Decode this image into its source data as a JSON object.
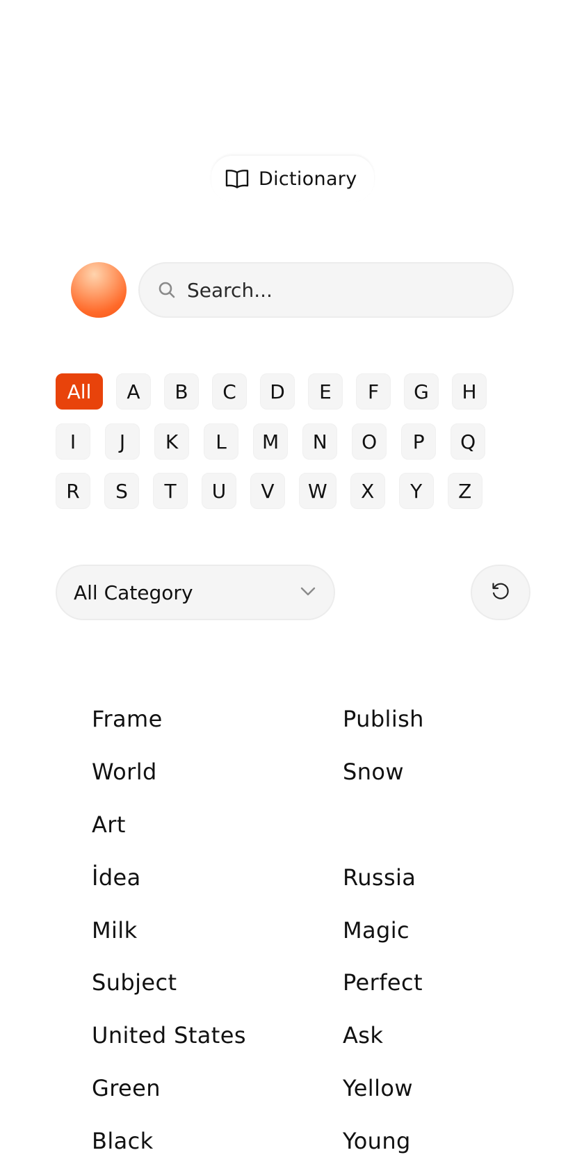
{
  "header": {
    "title": "Dictionary",
    "icon": "book-open-icon"
  },
  "search": {
    "placeholder": "Search...",
    "value": ""
  },
  "colors": {
    "accent": "#e8430b",
    "chip_bg": "#f5f5f5",
    "text": "#111111"
  },
  "letters": {
    "row1": [
      "All",
      "A",
      "B",
      "C",
      "D",
      "E",
      "F",
      "G",
      "H"
    ],
    "row2": [
      "I",
      "J",
      "K",
      "L",
      "M",
      "N",
      "O",
      "P",
      "Q"
    ],
    "row3": [
      "R",
      "S",
      "T",
      "U",
      "V",
      "W",
      "X",
      "Y",
      "Z"
    ],
    "active": "All"
  },
  "category": {
    "selected": "All Category"
  },
  "reset": {
    "icon": "reset-icon"
  },
  "words": [
    [
      "Frame",
      "Publish"
    ],
    [
      "World",
      "Snow"
    ],
    [
      "Art",
      ""
    ],
    [
      "İdea",
      "Russia"
    ],
    [
      "Milk",
      "Magic"
    ],
    [
      "Subject",
      "Perfect"
    ],
    [
      "United States",
      "Ask"
    ],
    [
      "Green",
      "Yellow"
    ],
    [
      "Black",
      "Young"
    ]
  ]
}
